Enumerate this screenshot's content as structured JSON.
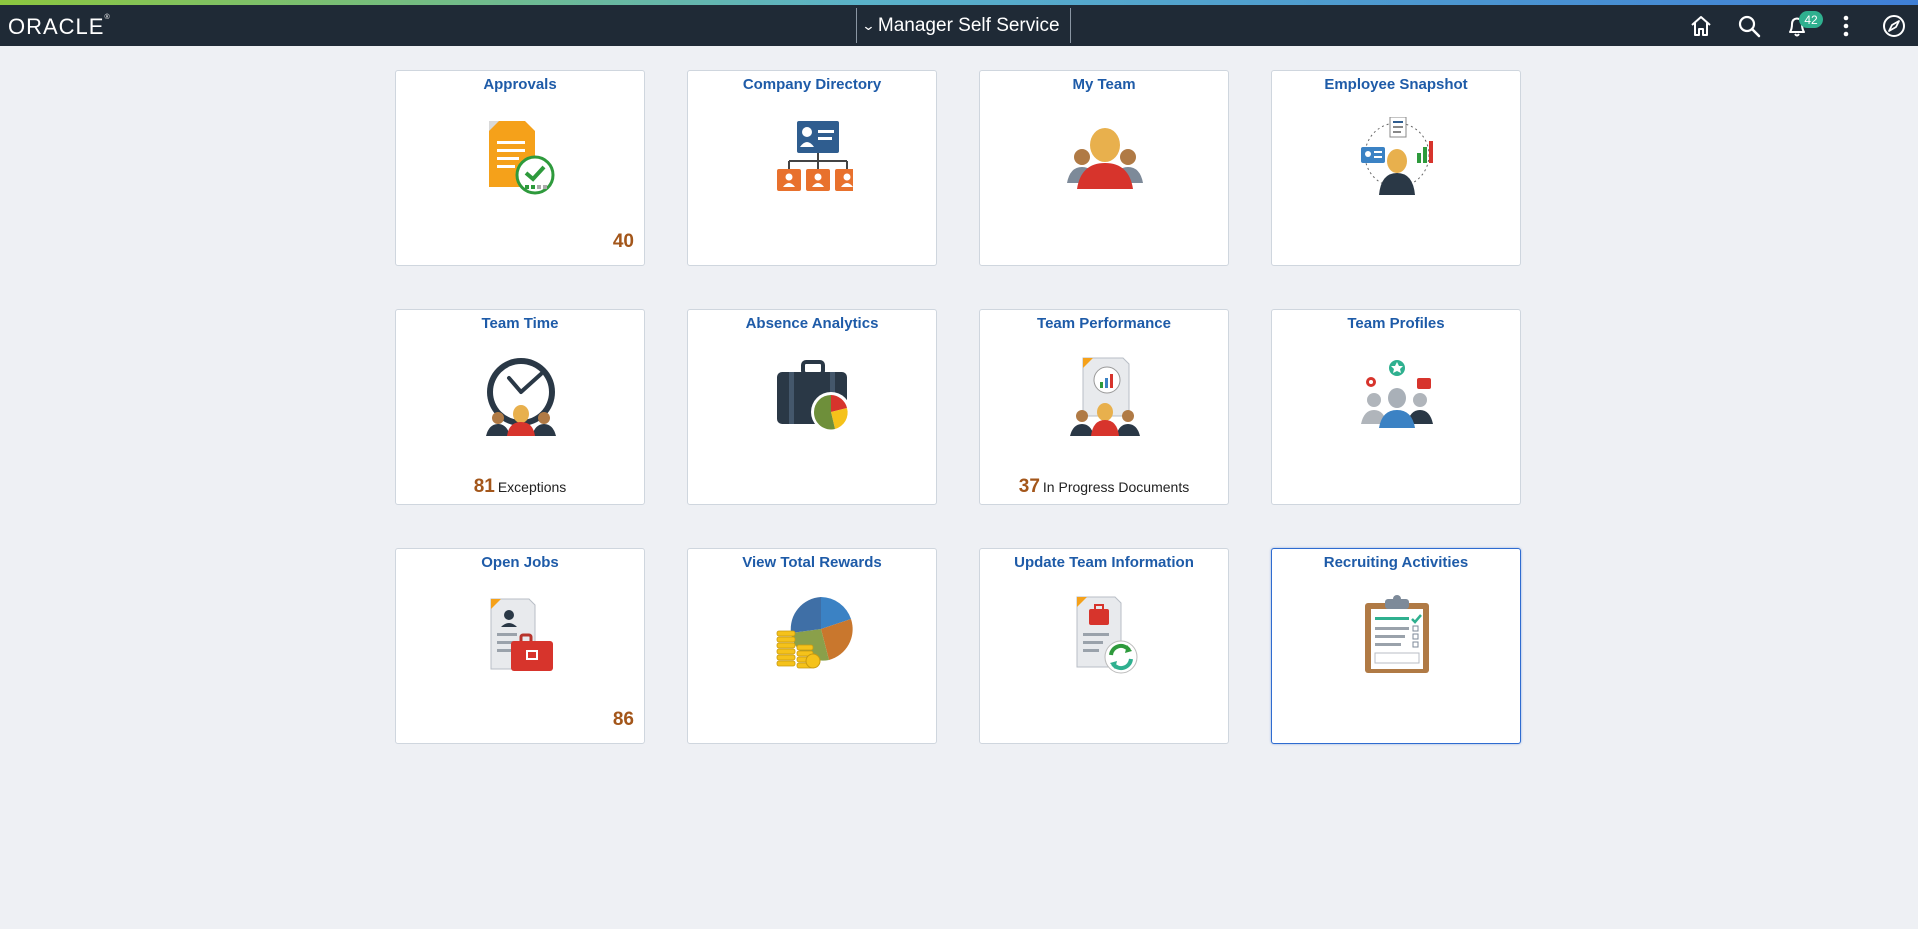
{
  "header": {
    "logo": "ORACLE",
    "logo_mark": "®",
    "title": "Manager Self Service",
    "notifications_count": "42",
    "icons": [
      "home-icon",
      "search-icon",
      "bell-icon",
      "more-vertical-icon",
      "compass-icon"
    ]
  },
  "tiles": [
    {
      "title": "Approvals",
      "icon": "approvals-icon",
      "count": "40"
    },
    {
      "title": "Company Directory",
      "icon": "org-chart-icon"
    },
    {
      "title": "My Team",
      "icon": "team-people-icon"
    },
    {
      "title": "Employee Snapshot",
      "icon": "employee-snapshot-icon"
    },
    {
      "title": "Team Time",
      "icon": "clock-team-icon",
      "count": "81",
      "count_label": "Exceptions"
    },
    {
      "title": "Absence Analytics",
      "icon": "briefcase-chart-icon"
    },
    {
      "title": "Team Performance",
      "icon": "performance-document-icon",
      "count": "37",
      "count_label": "In Progress Documents"
    },
    {
      "title": "Team Profiles",
      "icon": "team-profiles-icon"
    },
    {
      "title": "Open Jobs",
      "icon": "job-posting-icon",
      "count": "86"
    },
    {
      "title": "View Total Rewards",
      "icon": "rewards-pie-icon"
    },
    {
      "title": "Update Team Information",
      "icon": "document-refresh-icon"
    },
    {
      "title": "Recruiting Activities",
      "icon": "clipboard-checklist-icon"
    }
  ],
  "colors": {
    "header_bg": "#1f2a36",
    "page_bg": "#eef0f4",
    "tile_title": "#1e5ba8",
    "count": "#a3561a",
    "badge": "#2fb08f",
    "focus_border": "#2f6cd0"
  }
}
